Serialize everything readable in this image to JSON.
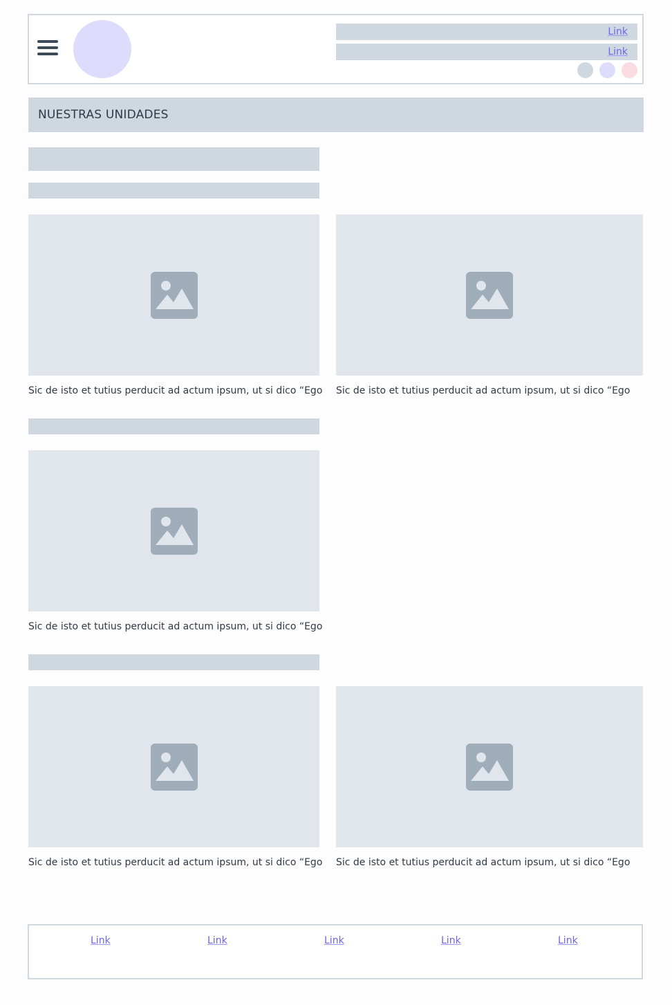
{
  "header": {
    "menu_icon": "hamburger-menu-icon",
    "top_links": [
      "Link",
      "Link"
    ],
    "dot_colors": [
      "#cfd8e1",
      "#dedcfd",
      "#fadbe1"
    ]
  },
  "section": {
    "title": "NUESTRAS UNIDADES"
  },
  "cards": [
    {
      "caption": "Sic de isto et tutius perducit ad actum ipsum, ut si dico “Ego"
    },
    {
      "caption": "Sic de isto et tutius perducit ad actum ipsum, ut si dico “Ego"
    },
    {
      "caption": "Sic de isto et tutius perducit ad actum ipsum, ut si dico “Ego"
    },
    {
      "caption": "Sic de isto et tutius perducit ad actum ipsum, ut si dico “Ego"
    },
    {
      "caption": "Sic de isto et tutius perducit ad actum ipsum, ut si dico “Ego"
    }
  ],
  "footer": {
    "links": [
      "Link",
      "Link",
      "Link",
      "Link",
      "Link"
    ]
  },
  "colors": {
    "placeholder": "#cfd8e1",
    "image_bg": "#e0e6eb",
    "image_icon": "#9eadb9",
    "link": "#6b63ec"
  }
}
